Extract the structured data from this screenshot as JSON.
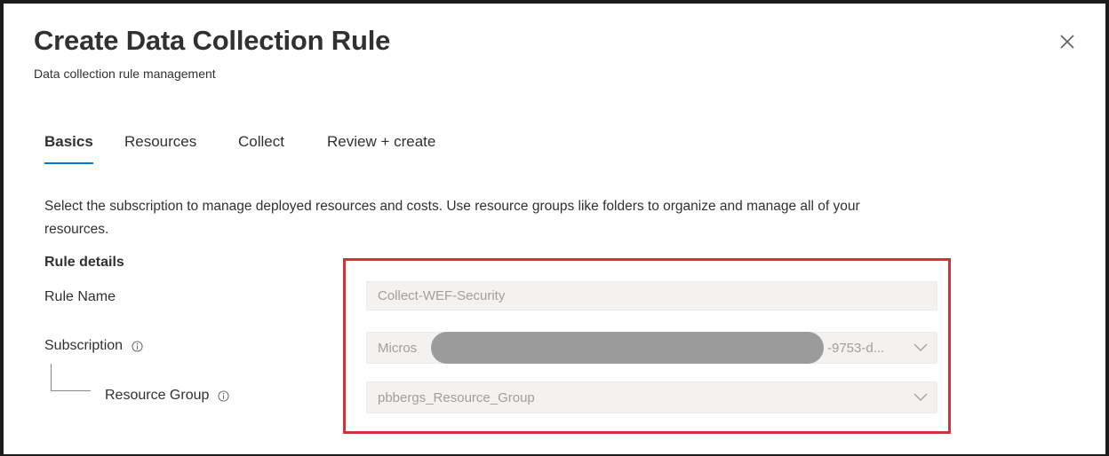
{
  "header": {
    "title": "Create Data Collection Rule",
    "subtitle": "Data collection rule management"
  },
  "tabs": [
    {
      "label": "Basics",
      "active": true
    },
    {
      "label": "Resources",
      "active": false
    },
    {
      "label": "Collect",
      "active": false
    },
    {
      "label": "Review + create",
      "active": false
    }
  ],
  "description": "Select the subscription to manage deployed resources and costs. Use resource groups like folders to organize and manage all of your resources.",
  "rule_details": {
    "section_title": "Rule details",
    "rule_name": {
      "label": "Rule Name",
      "value": "Collect-WEF-Security"
    },
    "subscription": {
      "label": "Subscription",
      "value_prefix": "Micros",
      "value_suffix": "-9753-d..."
    },
    "resource_group": {
      "label": "Resource Group",
      "value": "pbbergs_Resource_Group"
    }
  },
  "icons": {
    "close": "close-icon",
    "info": "info-icon",
    "chevron": "chevron-down-icon"
  },
  "colors": {
    "accent": "#0078d4",
    "highlight": "#d13438",
    "field_background": "#f3f2f1",
    "disabled_text": "#a19f9d"
  }
}
